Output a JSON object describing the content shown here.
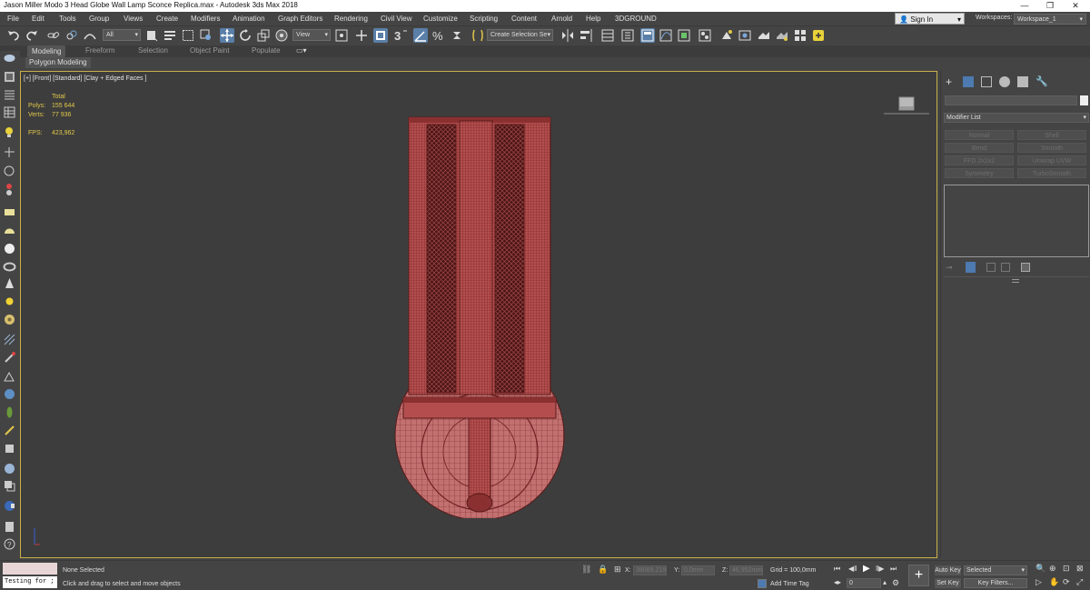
{
  "window": {
    "title": "Jason Miller Modo 3 Head Globe Wall Lamp Sconce Replica.max - Autodesk 3ds Max 2018",
    "controls": [
      "—",
      "❐",
      "✕"
    ]
  },
  "menu": {
    "items": [
      "File",
      "Edit",
      "Tools",
      "Group",
      "Views",
      "Create",
      "Modifiers",
      "Animation",
      "Graph Editors",
      "Rendering",
      "Civil View",
      "Customize",
      "Scripting",
      "Content",
      "Arnold",
      "Help",
      "3DGROUND"
    ],
    "sign_in": "Sign In",
    "workspaces_label": "Workspaces:",
    "workspace_value": "Workspace_1"
  },
  "toolbar": {
    "selection_filter": "All",
    "ref_coord": "View",
    "named_selection": "Create Selection Se",
    "snap_label": "3"
  },
  "ribbon": {
    "tabs": [
      "Modeling",
      "Freeform",
      "Selection",
      "Object Paint",
      "Populate"
    ],
    "active_tab": "Modeling",
    "panel_label": "Polygon Modeling"
  },
  "viewport": {
    "label": "[+] [Front] [Standard] [Clay + Edged Faces ]",
    "stats": {
      "total_label": "Total",
      "polys_label": "Polys:",
      "polys_value": "155 644",
      "verts_label": "Verts:",
      "verts_value": "77 936",
      "fps_label": "FPS:",
      "fps_value": "423,962"
    },
    "colors": {
      "wire": "#6e1f1f",
      "fill": "#b44e4e",
      "highlight": "#c9b04a"
    }
  },
  "command_panel": {
    "modifier_list": "Modifier List",
    "buttons": [
      "Normal",
      "Shell",
      "Bend",
      "Smooth",
      "FFD 2x2x2",
      "Unwrap UVW",
      "Symmetry",
      "TurboSmooth"
    ]
  },
  "status": {
    "script_prompt": "Testing for ;",
    "selection": "None Selected",
    "prompt": "Click and drag to select and move objects",
    "x_label": "X:",
    "x_value": "38089,219",
    "y_label": "Y:",
    "y_value": "0,0mm",
    "z_label": "Z:",
    "z_value": "46,952mm",
    "grid": "Grid = 100,0mm",
    "add_time_tag": "Add Time Tag",
    "auto_key": "Auto Key",
    "set_key": "Set Key",
    "key_mode": "Selected",
    "key_filters": "Key Filters...",
    "frame": "0"
  }
}
